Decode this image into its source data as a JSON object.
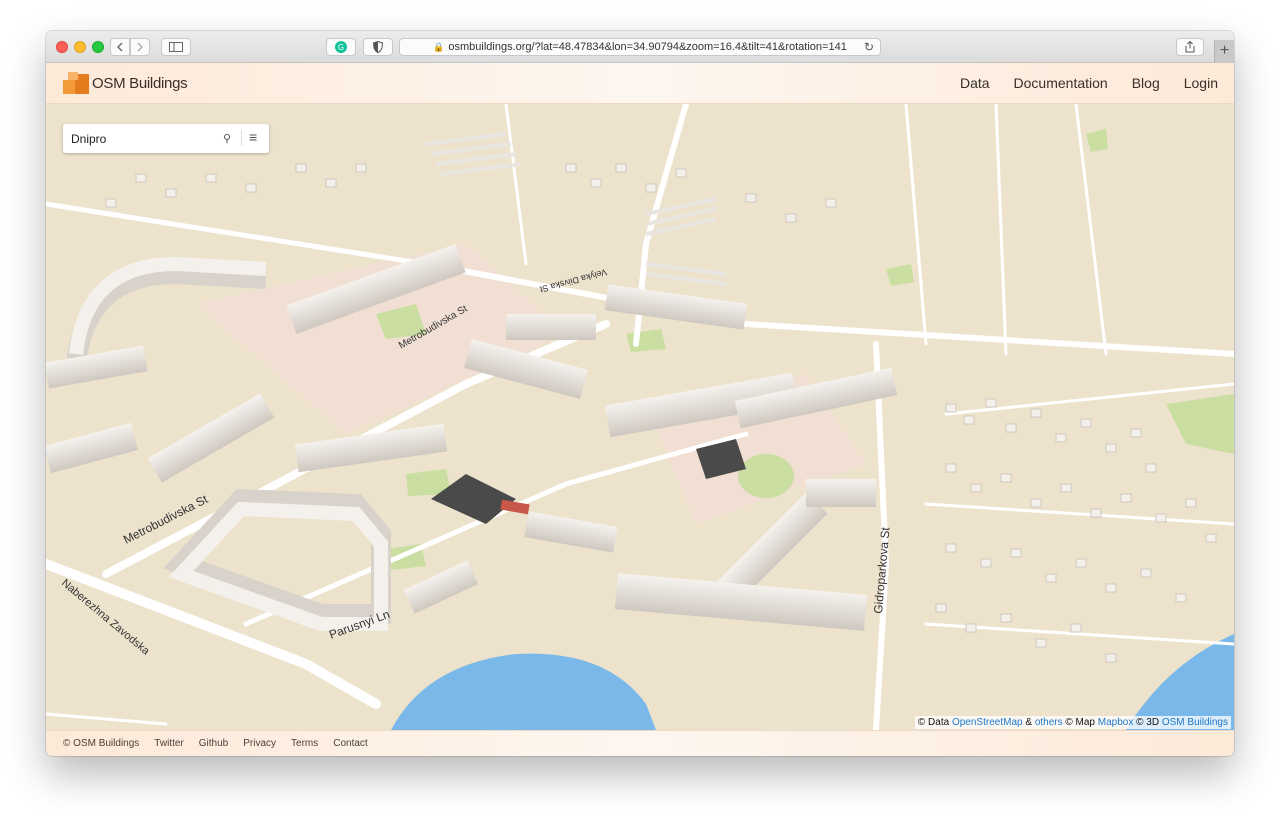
{
  "browser": {
    "url": "osmbuildings.org/?lat=48.47834&lon=34.90794&zoom=16.4&tilt=41&rotation=141",
    "new_tab": "+"
  },
  "header": {
    "brand": "OSM Buildings",
    "nav": [
      "Data",
      "Documentation",
      "Blog",
      "Login"
    ]
  },
  "search": {
    "value": "Dnipro"
  },
  "map": {
    "street_labels": [
      "Metrobudivska St",
      "Metrobudivska St",
      "Parusnyi Ln",
      "Gidroparkova St",
      "Velyka Diivska St",
      "Naberezhna Zavodska"
    ],
    "colors": {
      "land": "#ede3cd",
      "water": "#79b8e8",
      "park": "#c9dea0",
      "building": "#f2efea",
      "road": "#ffffff"
    }
  },
  "attribution": {
    "prefix": "© Data",
    "osm": "OpenStreetMap",
    "amp": "&",
    "others": "others",
    "map_prefix": "© Map",
    "mapbox": "Mapbox",
    "threed_prefix": "© 3D",
    "osmb": "OSM Buildings"
  },
  "footer": {
    "links": [
      "© OSM Buildings",
      "Twitter",
      "Github",
      "Privacy",
      "Terms",
      "Contact"
    ]
  }
}
